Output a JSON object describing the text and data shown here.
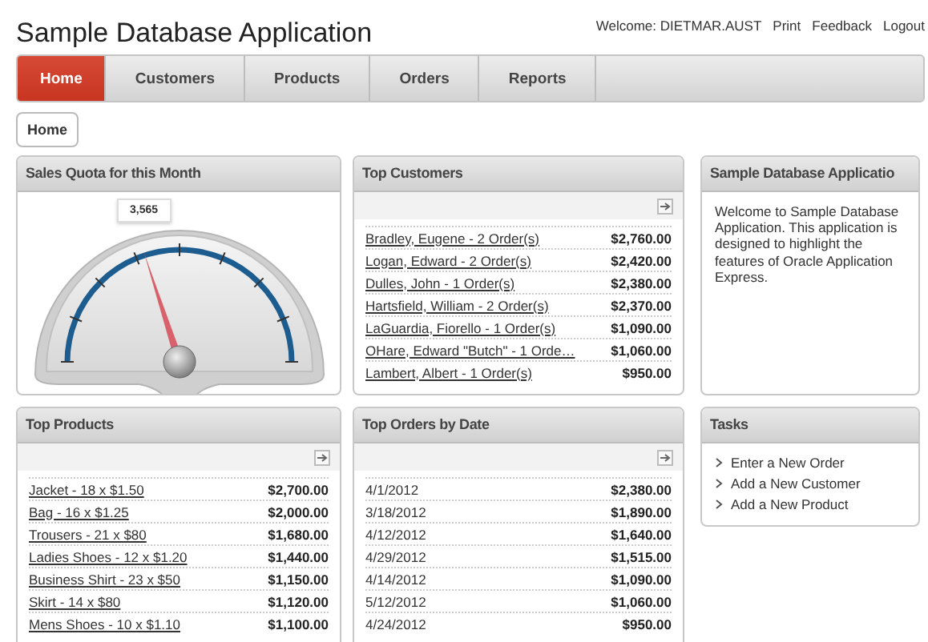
{
  "header": {
    "title": "Sample Database Application",
    "welcome": "Welcome: DIETMAR.AUST",
    "links": [
      "Print",
      "Feedback",
      "Logout"
    ]
  },
  "tabs": [
    {
      "label": "Home",
      "selected": true
    },
    {
      "label": "Customers",
      "selected": false
    },
    {
      "label": "Products",
      "selected": false
    },
    {
      "label": "Orders",
      "selected": false
    },
    {
      "label": "Reports",
      "selected": false
    }
  ],
  "breadcrumb": "Home",
  "regions": [
    {
      "kind": "gauge",
      "title": "Sales Quota for this Month",
      "value": "3,565"
    },
    {
      "kind": "report",
      "title": "Top Customers",
      "linked": true,
      "rows": [
        {
          "label": "Bradley, Eugene - 2 Order(s)",
          "amount": "$2,760.00"
        },
        {
          "label": "Logan, Edward - 2 Order(s)",
          "amount": "$2,420.00"
        },
        {
          "label": "Dulles, John - 1 Order(s)",
          "amount": "$2,380.00"
        },
        {
          "label": "Hartsfield, William - 2 Order(s)",
          "amount": "$2,370.00"
        },
        {
          "label": "LaGuardia, Fiorello - 1 Order(s)",
          "amount": "$1,090.00"
        },
        {
          "label": "OHare, Edward \"Butch\" - 1 Orde…",
          "amount": "$1,060.00"
        },
        {
          "label": "Lambert, Albert - 1 Order(s)",
          "amount": "$950.00"
        }
      ]
    },
    {
      "kind": "text",
      "title": "Sample Database Applicatio",
      "body": "Welcome to Sample Database Application. This application is designed to highlight the features of Oracle Application Express."
    },
    {
      "kind": "report",
      "title": "Top Products",
      "linked": true,
      "rows": [
        {
          "label": "Jacket - 18 x $1.50",
          "amount": "$2,700.00"
        },
        {
          "label": "Bag - 16 x $1.25",
          "amount": "$2,000.00"
        },
        {
          "label": "Trousers - 21 x $80",
          "amount": "$1,680.00"
        },
        {
          "label": "Ladies Shoes - 12 x $1.20",
          "amount": "$1,440.00"
        },
        {
          "label": "Business Shirt - 23 x $50",
          "amount": "$1,150.00"
        },
        {
          "label": "Skirt - 14 x $80",
          "amount": "$1,120.00"
        },
        {
          "label": "Mens Shoes - 10 x $1.10",
          "amount": "$1,100.00"
        }
      ]
    },
    {
      "kind": "report",
      "title": "Top Orders by Date",
      "linked": false,
      "rows": [
        {
          "label": "4/1/2012",
          "amount": "$2,380.00"
        },
        {
          "label": "3/18/2012",
          "amount": "$1,890.00"
        },
        {
          "label": "4/12/2012",
          "amount": "$1,640.00"
        },
        {
          "label": "4/29/2012",
          "amount": "$1,515.00"
        },
        {
          "label": "4/14/2012",
          "amount": "$1,090.00"
        },
        {
          "label": "5/12/2012",
          "amount": "$1,060.00"
        },
        {
          "label": "4/24/2012",
          "amount": "$950.00"
        }
      ]
    },
    {
      "kind": "list",
      "title": "Tasks",
      "items": [
        "Enter a New Order",
        "Add a New Customer",
        "Add a New Product"
      ]
    }
  ]
}
